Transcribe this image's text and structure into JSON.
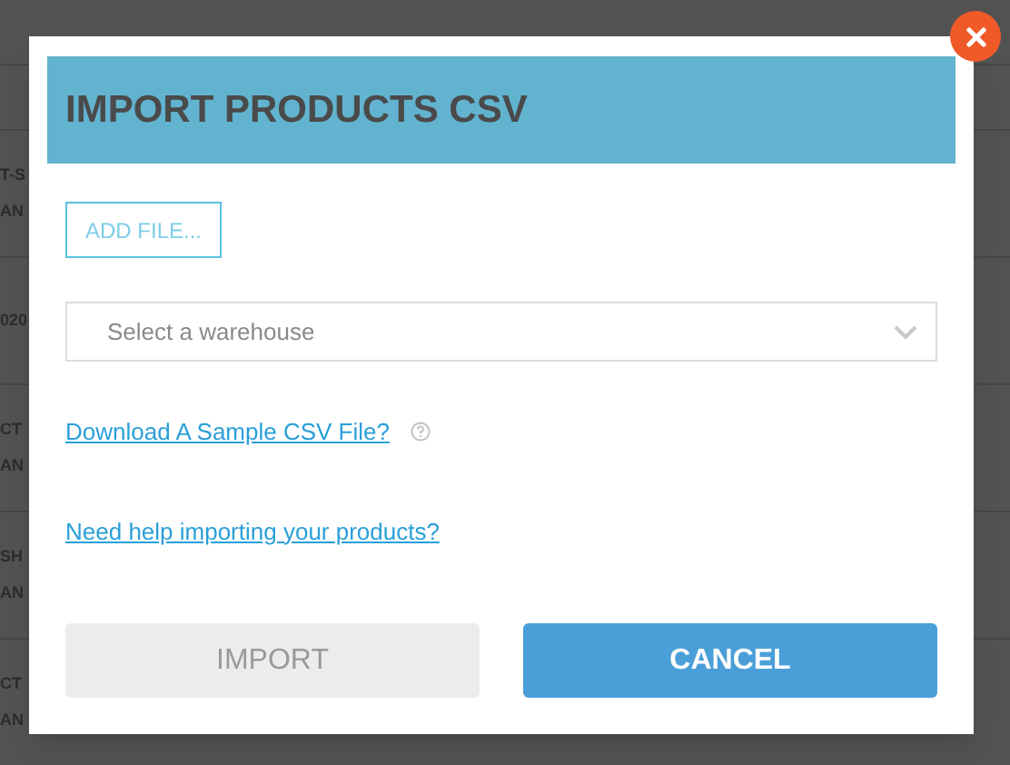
{
  "background_rows": [
    {
      "line_1": "T-S",
      "line_2": "AN"
    },
    {
      "line_1": "020"
    },
    {
      "line_1": "CT",
      "line_2": "AN"
    },
    {
      "line_1": "SH",
      "line_2": "AN"
    },
    {
      "line_1": "CT",
      "line_2": "AN"
    }
  ],
  "dialog": {
    "title": "IMPORT PRODUCTS CSV",
    "add_file_button": "ADD FILE...",
    "warehouse_select": {
      "placeholder": "Select a warehouse"
    },
    "sample_link": "Download A Sample CSV File?",
    "help_link": "Need help importing your products?",
    "import_button": {
      "label": "IMPORT",
      "disabled": true
    },
    "cancel_button": "CANCEL"
  }
}
